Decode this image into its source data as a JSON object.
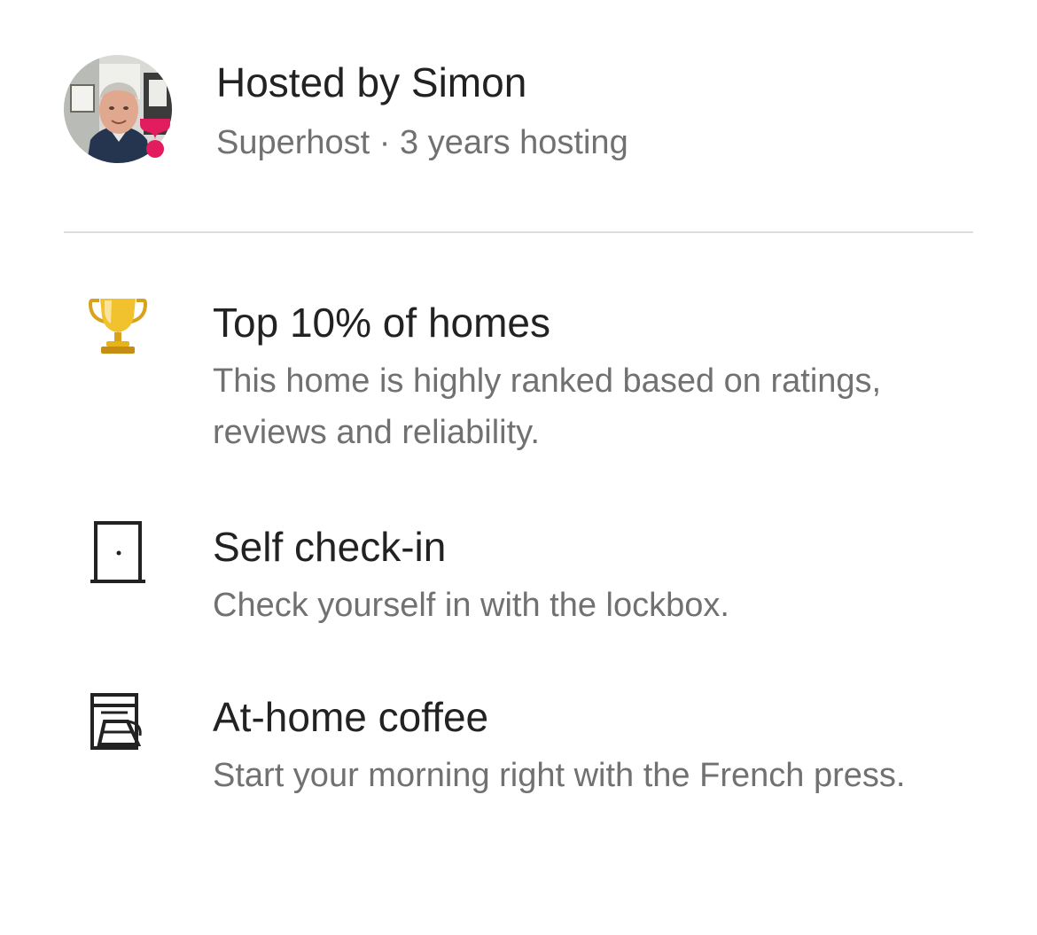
{
  "host": {
    "name": "Hosted by Simon",
    "subtitle": "Superhost · 3 years hosting"
  },
  "highlights": [
    {
      "icon": "trophy-icon",
      "title": "Top 10% of homes",
      "description": "This home is highly ranked based on ratings, reviews and reliability."
    },
    {
      "icon": "door-icon",
      "title": "Self check-in",
      "description": "Check yourself in with the lockbox."
    },
    {
      "icon": "coffee-maker-icon",
      "title": "At-home coffee",
      "description": "Start your morning right with the French press."
    }
  ],
  "colors": {
    "primary_text": "#222222",
    "secondary_text": "#717171",
    "divider": "#dddddd",
    "superhost_badge": "#e31c5f",
    "trophy_gold": "#e8b318"
  }
}
